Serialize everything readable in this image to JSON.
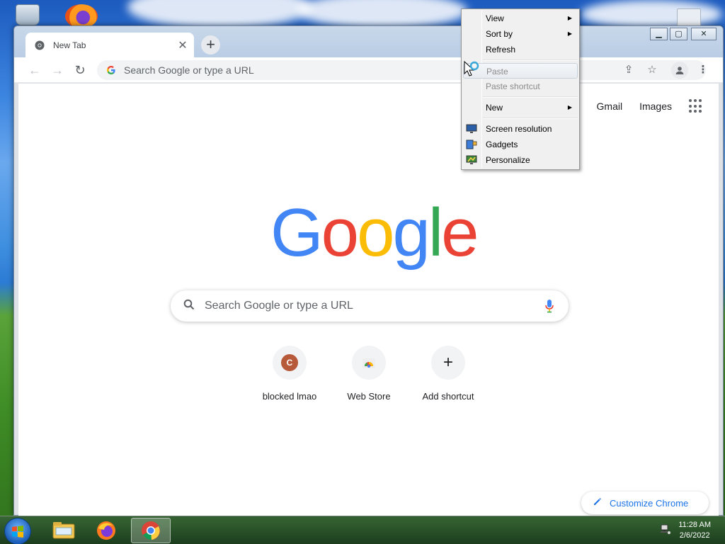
{
  "browser": {
    "tab_title": "New Tab",
    "tab_close": "✕",
    "new_tab": "+",
    "omnibox_placeholder": "Search Google or type a URL",
    "window_controls": {
      "minimize": "▁",
      "maximize": "▢",
      "close": "✕"
    }
  },
  "ntp": {
    "links": [
      "Gmail",
      "Images"
    ],
    "logo_letters": [
      {
        "ch": "G",
        "color": "#4285F4"
      },
      {
        "ch": "o",
        "color": "#EA4335"
      },
      {
        "ch": "o",
        "color": "#FBBC05"
      },
      {
        "ch": "g",
        "color": "#4285F4"
      },
      {
        "ch": "l",
        "color": "#34A853"
      },
      {
        "ch": "e",
        "color": "#EA4335"
      }
    ],
    "search_placeholder": "Search Google or type a URL",
    "shortcuts": [
      {
        "label": "blocked lmao",
        "initial": "C"
      },
      {
        "label": "Web Store"
      },
      {
        "label": "Add shortcut",
        "symbol": "+"
      }
    ],
    "customize_label": "Customize Chrome"
  },
  "context_menu": {
    "items": [
      {
        "label": "View",
        "submenu": true
      },
      {
        "label": "Sort by",
        "submenu": true
      },
      {
        "label": "Refresh"
      },
      {
        "label": "Paste",
        "disabled": true
      },
      {
        "label": "Paste shortcut",
        "disabled": true
      },
      {
        "label": "New",
        "submenu": true
      },
      {
        "label": "Screen resolution",
        "icon": "display-icon"
      },
      {
        "label": "Gadgets",
        "icon": "gadgets-icon"
      },
      {
        "label": "Personalize",
        "icon": "personalize-icon"
      }
    ]
  },
  "taskbar": {
    "time": "11:28 AM",
    "date": "2/6/2022"
  }
}
